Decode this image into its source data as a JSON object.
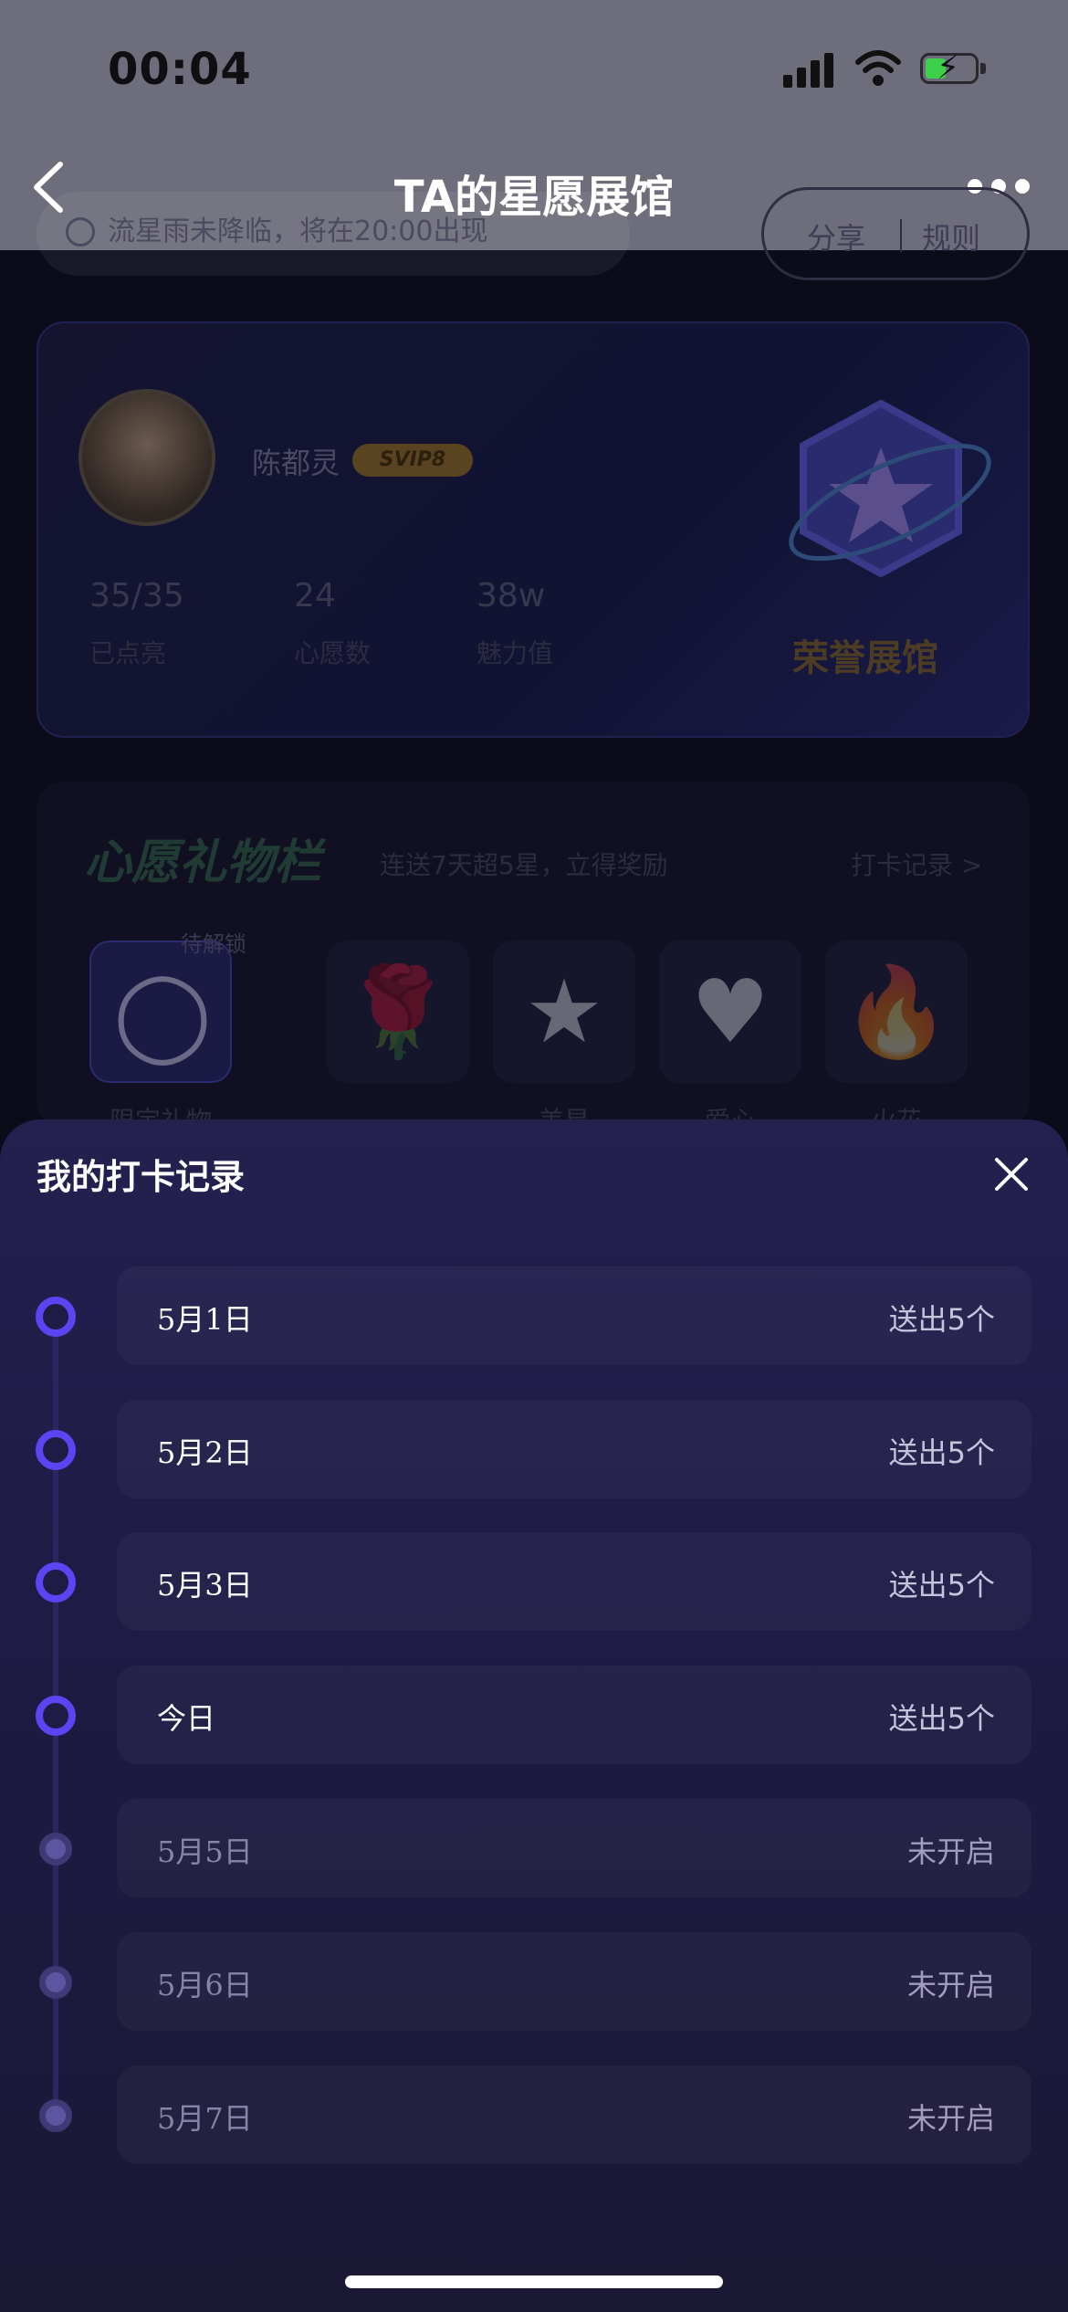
{
  "status_bar": {
    "time": "00:04"
  },
  "header": {
    "title": "TA的星愿展馆"
  },
  "background": {
    "notice_text": "流星雨未降临，将在20:00出现",
    "share_label": "分享",
    "rule_label": "规则",
    "profile": {
      "name": "陈都灵",
      "vip_badge": "SVIP8",
      "stats": [
        {
          "value": "35/35",
          "label": "已点亮"
        },
        {
          "value": "24",
          "label": "心愿数"
        },
        {
          "value": "38w",
          "label": "魅力值"
        }
      ],
      "honor_label": "荣誉展馆"
    },
    "gift_bar": {
      "title": "心愿礼物栏",
      "subtitle": "连送7天超5星，立得奖励",
      "record_link": "打卡记录 >",
      "locked_label": "待解锁",
      "items": [
        {
          "name": "限定礼物",
          "icon": "frame-icon"
        },
        {
          "name": "",
          "icon": "rose-icon"
        },
        {
          "name": "美星",
          "icon": "star-icon"
        },
        {
          "name": "爱心",
          "icon": "heart-icon"
        },
        {
          "name": "火花",
          "icon": "fire-icon"
        }
      ]
    }
  },
  "sheet": {
    "title": "我的打卡记录",
    "records": [
      {
        "date": "5月1日",
        "status": "送出5个",
        "active": true
      },
      {
        "date": "5月2日",
        "status": "送出5个",
        "active": true
      },
      {
        "date": "5月3日",
        "status": "送出5个",
        "active": true
      },
      {
        "date": "今日",
        "status": "送出5个",
        "active": true
      },
      {
        "date": "5月5日",
        "status": "未开启",
        "active": false
      },
      {
        "date": "5月6日",
        "status": "未开启",
        "active": false
      },
      {
        "date": "5月7日",
        "status": "未开启",
        "active": false
      }
    ]
  },
  "colors": {
    "accent": "#5b45f2",
    "sheet_bg": "#24204f",
    "header_bg": "#6e6d7b"
  }
}
